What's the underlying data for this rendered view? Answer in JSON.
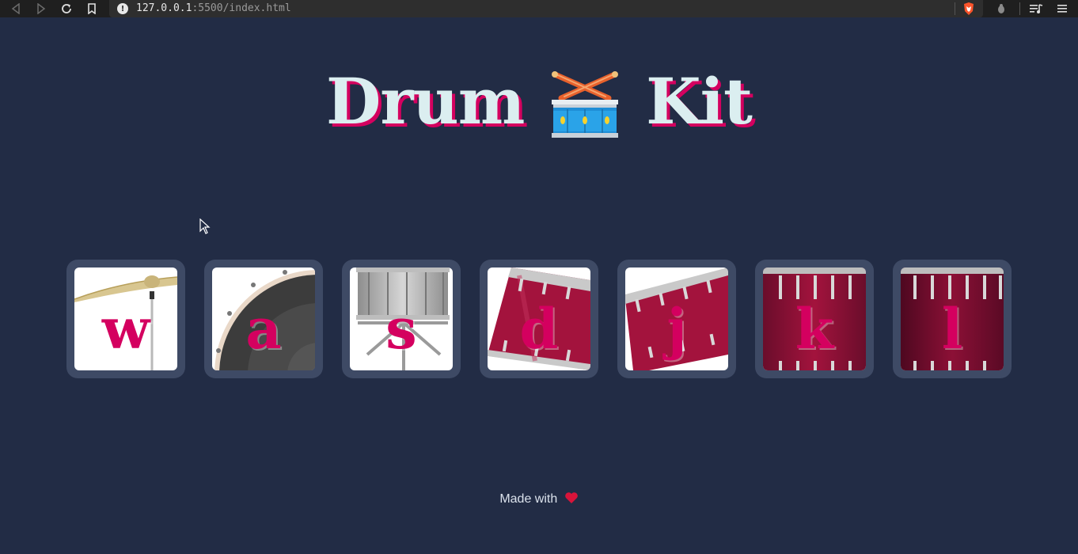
{
  "browser": {
    "url_host": "127.0.0.1",
    "url_rest": ":5500/index.html",
    "icons": [
      "back-icon",
      "forward-icon",
      "reload-icon",
      "bookmark-icon",
      "info-icon",
      "brave-shield-icon",
      "extension-icon",
      "media-icon",
      "menu-icon"
    ]
  },
  "header": {
    "title_left": "Drum",
    "title_right": "Kit",
    "emoji": "drum-icon"
  },
  "keys": [
    {
      "letter": "w",
      "instrument": "crash"
    },
    {
      "letter": "a",
      "instrument": "kick"
    },
    {
      "letter": "s",
      "instrument": "snare"
    },
    {
      "letter": "d",
      "instrument": "tom-1"
    },
    {
      "letter": "j",
      "instrument": "tom-2"
    },
    {
      "letter": "k",
      "instrument": "tom-3"
    },
    {
      "letter": "l",
      "instrument": "tom-4"
    }
  ],
  "footer": {
    "text": "Made with",
    "icon": "heart-icon"
  },
  "colors": {
    "background": "#222c45",
    "key_border": "#3e4a65",
    "accent": "#d4005f",
    "title": "#dbeef0"
  }
}
